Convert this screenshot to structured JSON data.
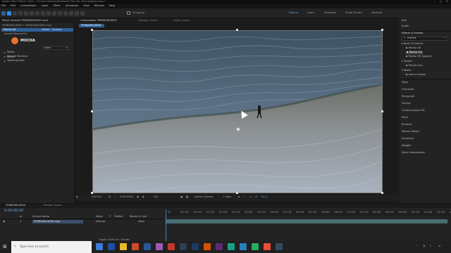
{
  "window": {
    "title": "Adobe After Effects 2020 - C:\\Users\\Alexey\\Desktop\\3 Tips for mocha\\plates.aep *"
  },
  "menu": [
    "File",
    "Edit",
    "Composition",
    "Layer",
    "Effect",
    "Animation",
    "View",
    "Window",
    "Help"
  ],
  "toolbar": {
    "snapping_label": "Snapping",
    "workspaces": [
      "Default",
      "Learn",
      "Standard",
      "Small Screen",
      "Libraries"
    ],
    "search_placeholder": "Search Help"
  },
  "left_panel": {
    "tab": "Effect Controls FR9BA0824D00.mp4",
    "breadcrumb": "FR9BA0824D00 • FR9BA0824D00.mp4",
    "effect_name": "Mocha AE",
    "reset_label": "Reset",
    "license_label": "License",
    "launch_label": "Launch Mocha Pro",
    "logo_text": "MOCHA",
    "rows": [
      {
        "label": "Matte",
        "value": "None"
      },
      {
        "label": "Matte"
      },
      {
        "label": "Module Renders"
      },
      {
        "label": "Tracking Data"
      }
    ]
  },
  "comp_panel": {
    "tab": "Composition FR9BA0824D00",
    "footage_tab": "Footage (none)",
    "layer_tab": "Layer (none)",
    "sub_tab": "FR9BA0824D00",
    "status": {
      "zoom": "(34.4%)",
      "timecode": "0:00:00:00",
      "resolution": "Full",
      "camera": "Active Camera",
      "views": "1 View",
      "offset": "+0.0"
    }
  },
  "right_panel": {
    "tabs": [
      "Info",
      "Audio"
    ],
    "effects_title": "Effects & Presets",
    "search_value": "mocha",
    "tree": [
      {
        "label": "Boris FX Mocha",
        "level": 0
      },
      {
        "label": "Mocha AE",
        "level": 1
      },
      {
        "label": "Mocha Pro",
        "level": 1,
        "selected": true
      },
      {
        "label": "Mocha VR (legacy)",
        "level": 1
      },
      {
        "label": "Distort",
        "level": 0
      },
      {
        "label": "Mocha lens",
        "level": 1
      },
      {
        "label": "Matte",
        "level": 0
      },
      {
        "label": "mocha shape",
        "level": 1
      }
    ],
    "sections": [
      "Align",
      "Character",
      "Paragraph",
      "Tracker",
      "Content-Aware Fill",
      "Paint",
      "Brushes",
      "Motion Sketch",
      "Smoother",
      "Wiggler",
      "Mask Interpolation"
    ]
  },
  "timeline": {
    "tab": "FR9BA0824D00",
    "render_tab": "Render Queue",
    "timecode": "0:00:00:00",
    "columns": [
      "#",
      "Source Name",
      "Mode",
      "T",
      "TrkMat",
      "Parent & Link"
    ],
    "layer": {
      "num": "1",
      "name": "FR9BA0824D00.mp4",
      "mode": "Normal",
      "parent": "None"
    },
    "ruler": [
      "0s",
      "00:15f",
      "01:00f",
      "01:15f",
      "02:00f",
      "02:15f",
      "03:00f",
      "03:15f",
      "04:00f",
      "04:15f",
      "05:00f",
      "05:15f",
      "06:00f",
      "06:15f",
      "07:00f",
      "07:15f",
      "08:00f",
      "08:15f",
      "09:00f",
      "09:15f",
      "10:00f",
      "10:15f",
      "11:00f"
    ],
    "footer": "Toggle Switches / Modes"
  },
  "taskbar": {
    "search_placeholder": "Type here to search",
    "app_colors": [
      "#3a7bd5",
      "#1e4e9c",
      "#e8b92a",
      "#cc4b2b",
      "#2b5797",
      "#9b59b6",
      "#c0392b",
      "#2c3e50",
      "#1e3a5f",
      "#d35400",
      "#5b2c6f",
      "#16a085",
      "#2980b9",
      "#27ae60",
      "#e74c3c",
      "#34495e"
    ]
  },
  "colors": {
    "accent": "#2d8ceb",
    "mocha_orange": "#e8742a",
    "timeline_bar": "#4b6c73"
  }
}
